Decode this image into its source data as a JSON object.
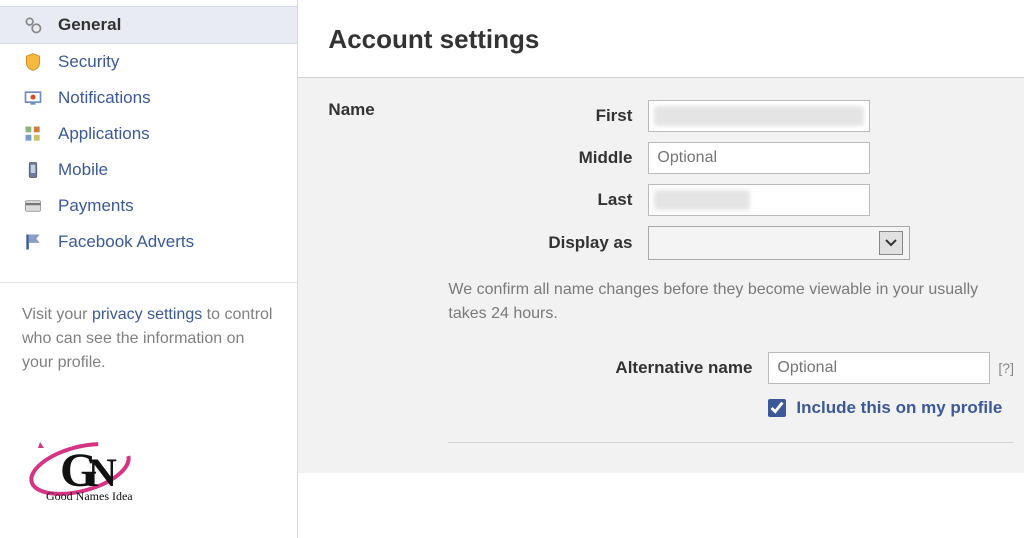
{
  "sidebar": {
    "items": [
      {
        "label": "General",
        "active": true
      },
      {
        "label": "Security",
        "active": false
      },
      {
        "label": "Notifications",
        "active": false
      },
      {
        "label": "Applications",
        "active": false
      },
      {
        "label": "Mobile",
        "active": false
      },
      {
        "label": "Payments",
        "active": false
      },
      {
        "label": "Facebook Adverts",
        "active": false
      }
    ],
    "note_prefix": "Visit your ",
    "note_link": "privacy settings",
    "note_suffix": " to control who can see the information on your profile.",
    "logo_text": "Good Names Idea"
  },
  "main": {
    "heading": "Account settings",
    "section_label": "Name",
    "labels": {
      "first": "First",
      "middle": "Middle",
      "last": "Last",
      "display_as": "Display as",
      "alt": "Alternative name"
    },
    "placeholders": {
      "middle": "Optional",
      "alt": "Optional"
    },
    "confirm_text": "We confirm all name changes before they become viewable in your usually takes 24 hours.",
    "help_mark": "[?]",
    "include_checkbox_label": "Include this on my profile",
    "include_checked": true
  }
}
